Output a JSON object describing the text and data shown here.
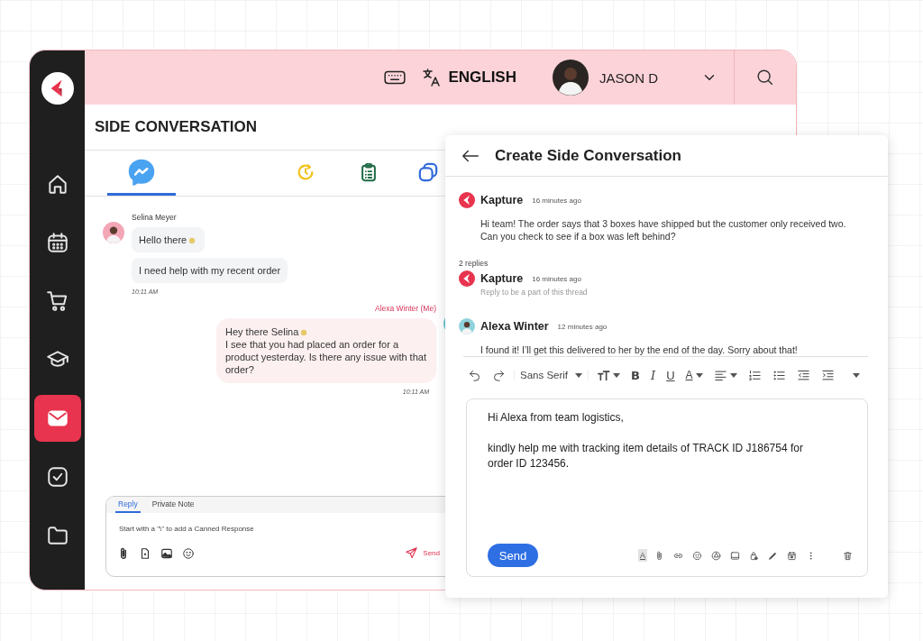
{
  "sidebar": {
    "items": [
      {
        "selected": false
      },
      {
        "selected": false
      },
      {
        "selected": false
      },
      {
        "selected": false
      },
      {
        "selected": true
      },
      {
        "selected": false
      },
      {
        "selected": false
      }
    ]
  },
  "header": {
    "language": "ENGLISH",
    "user": "JASON D"
  },
  "main": {
    "title": "SIDE CONVERSATION",
    "tabs": [
      {
        "selected": true
      },
      {
        "selected": false
      },
      {
        "selected": false
      },
      {
        "selected": false
      }
    ],
    "messages": [
      {
        "kind": "incoming",
        "author": "Selina Meyer",
        "bubbles": [
          {
            "text": "Hello there",
            "wave": true
          },
          {
            "text": "I need help with my recent order",
            "wave": false
          }
        ],
        "time": "10:11 AM"
      },
      {
        "kind": "outgoing",
        "author": "Alexa Winter (Me)",
        "bubbles": [
          {
            "text": "Hey there Selina",
            "wave": true,
            "after": "I see that you had placed an order for a product yesterday. Is there any issue with that order?"
          }
        ],
        "time": "10:11 AM"
      }
    ],
    "reply_box": {
      "tabs": [
        {
          "label": "Reply",
          "selected": true
        },
        {
          "label": "Private Note",
          "selected": false
        }
      ],
      "placeholder": "Start with a \"\\\" to add a Canned Response",
      "send": "Send"
    }
  },
  "side_panel": {
    "title": "Create Side Conversation",
    "post": {
      "kind": "brand",
      "author": "Kapture",
      "time": "16 minutes ago",
      "text": "Hi team! The order says that 3 boxes have shipped but the customer only received two. Can you check to see if a box was left behind?"
    },
    "replies_count": "2 replies",
    "replies": [
      {
        "kind": "brand",
        "author": "Kapture",
        "time": "16 minutes ago",
        "hint": "Reply to be a part of this thread"
      },
      {
        "kind": "person",
        "author": "Alexa Winter",
        "time": "12 minutes ago",
        "text": "I found it! I’ll get this delivered to her by the end of the day. Sorry about that!"
      }
    ],
    "toolbar": [
      {
        "kind": "undo"
      },
      {
        "kind": "redo"
      },
      {
        "kind": "font",
        "label": "Sans Serif"
      },
      {
        "kind": "size"
      },
      {
        "kind": "bold",
        "label": "B"
      },
      {
        "kind": "italic",
        "label": "I"
      },
      {
        "kind": "underline",
        "label": "U"
      },
      {
        "kind": "color",
        "label": "A"
      },
      {
        "kind": "align"
      },
      {
        "kind": "numbered"
      },
      {
        "kind": "bulleted"
      },
      {
        "kind": "outdent"
      },
      {
        "kind": "indent"
      },
      {
        "kind": "more"
      }
    ],
    "compose": {
      "lines": [
        "Hi Alexa from team logistics,",
        "kindly help me with tracking item details of TRACK ID J186754 for order ID 123456."
      ],
      "send": "Send",
      "tools": [
        {
          "kind": "format",
          "label": "A",
          "selected": true
        },
        {
          "kind": "attach"
        },
        {
          "kind": "link"
        },
        {
          "kind": "emoji"
        },
        {
          "kind": "drive"
        },
        {
          "kind": "photo"
        },
        {
          "kind": "lock"
        },
        {
          "kind": "pen"
        },
        {
          "kind": "calendar"
        },
        {
          "kind": "dots"
        },
        {
          "kind": "trash"
        }
      ]
    }
  }
}
